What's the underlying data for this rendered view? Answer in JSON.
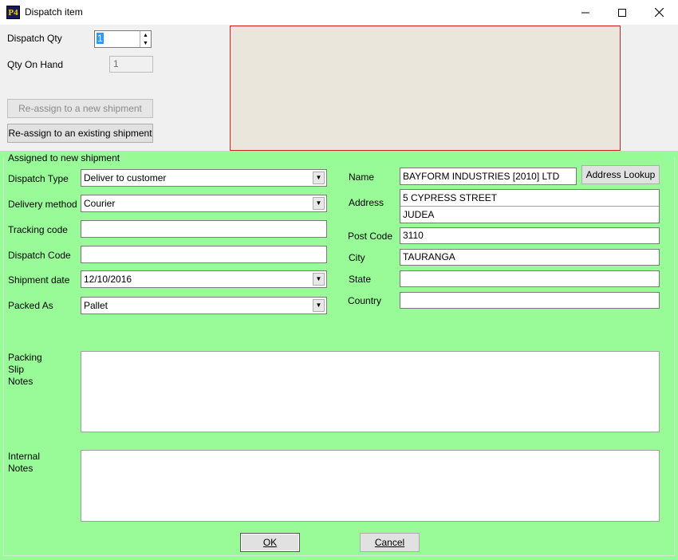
{
  "window": {
    "icon_text": "P4",
    "title": "Dispatch item"
  },
  "top": {
    "dispatch_qty_label": "Dispatch Qty",
    "dispatch_qty_value": "1",
    "qty_on_hand_label": "Qty On Hand",
    "qty_on_hand_value": "1",
    "reassign_new_label": "Re-assign to a new shipment",
    "reassign_existing_label": "Re-assign to an existing shipment"
  },
  "group": {
    "title": "Assigned to new shipment"
  },
  "left_fields": {
    "dispatch_type_label": "Dispatch Type",
    "dispatch_type_value": "Deliver to customer",
    "delivery_method_label": "Delivery method",
    "delivery_method_value": "Courier",
    "tracking_code_label": "Tracking code",
    "tracking_code_value": "",
    "dispatch_code_label": "Dispatch Code",
    "dispatch_code_value": "",
    "shipment_date_label": "Shipment date",
    "shipment_date_value": "12/10/2016",
    "packed_as_label": "Packed As",
    "packed_as_value": "Pallet"
  },
  "right_fields": {
    "name_label": "Name",
    "name_value": "BAYFORM INDUSTRIES [2010] LTD",
    "address_lookup_label": "Address Lookup",
    "address_label": "Address",
    "address_line1": "5 CYPRESS STREET",
    "address_line2": "JUDEA",
    "post_code_label": "Post Code",
    "post_code_value": "3110",
    "city_label": "City",
    "city_value": "TAURANGA",
    "state_label": "State",
    "state_value": "",
    "country_label": "Country",
    "country_value": ""
  },
  "notes": {
    "packing_label_1": "Packing",
    "packing_label_2": "Slip",
    "packing_label_3": "Notes",
    "internal_label_1": "Internal",
    "internal_label_2": "Notes"
  },
  "buttons": {
    "ok_label": "OK",
    "cancel_label": "Cancel"
  },
  "colors": {
    "form_background": "#98fb98",
    "preview_background": "#ebe6dc",
    "preview_border": "#d02020",
    "selection": "#3399ff"
  },
  "icons": [
    "minimize-icon",
    "maximize-icon",
    "close-icon",
    "spin-up-icon",
    "spin-down-icon",
    "dropdown-arrow-icon"
  ]
}
